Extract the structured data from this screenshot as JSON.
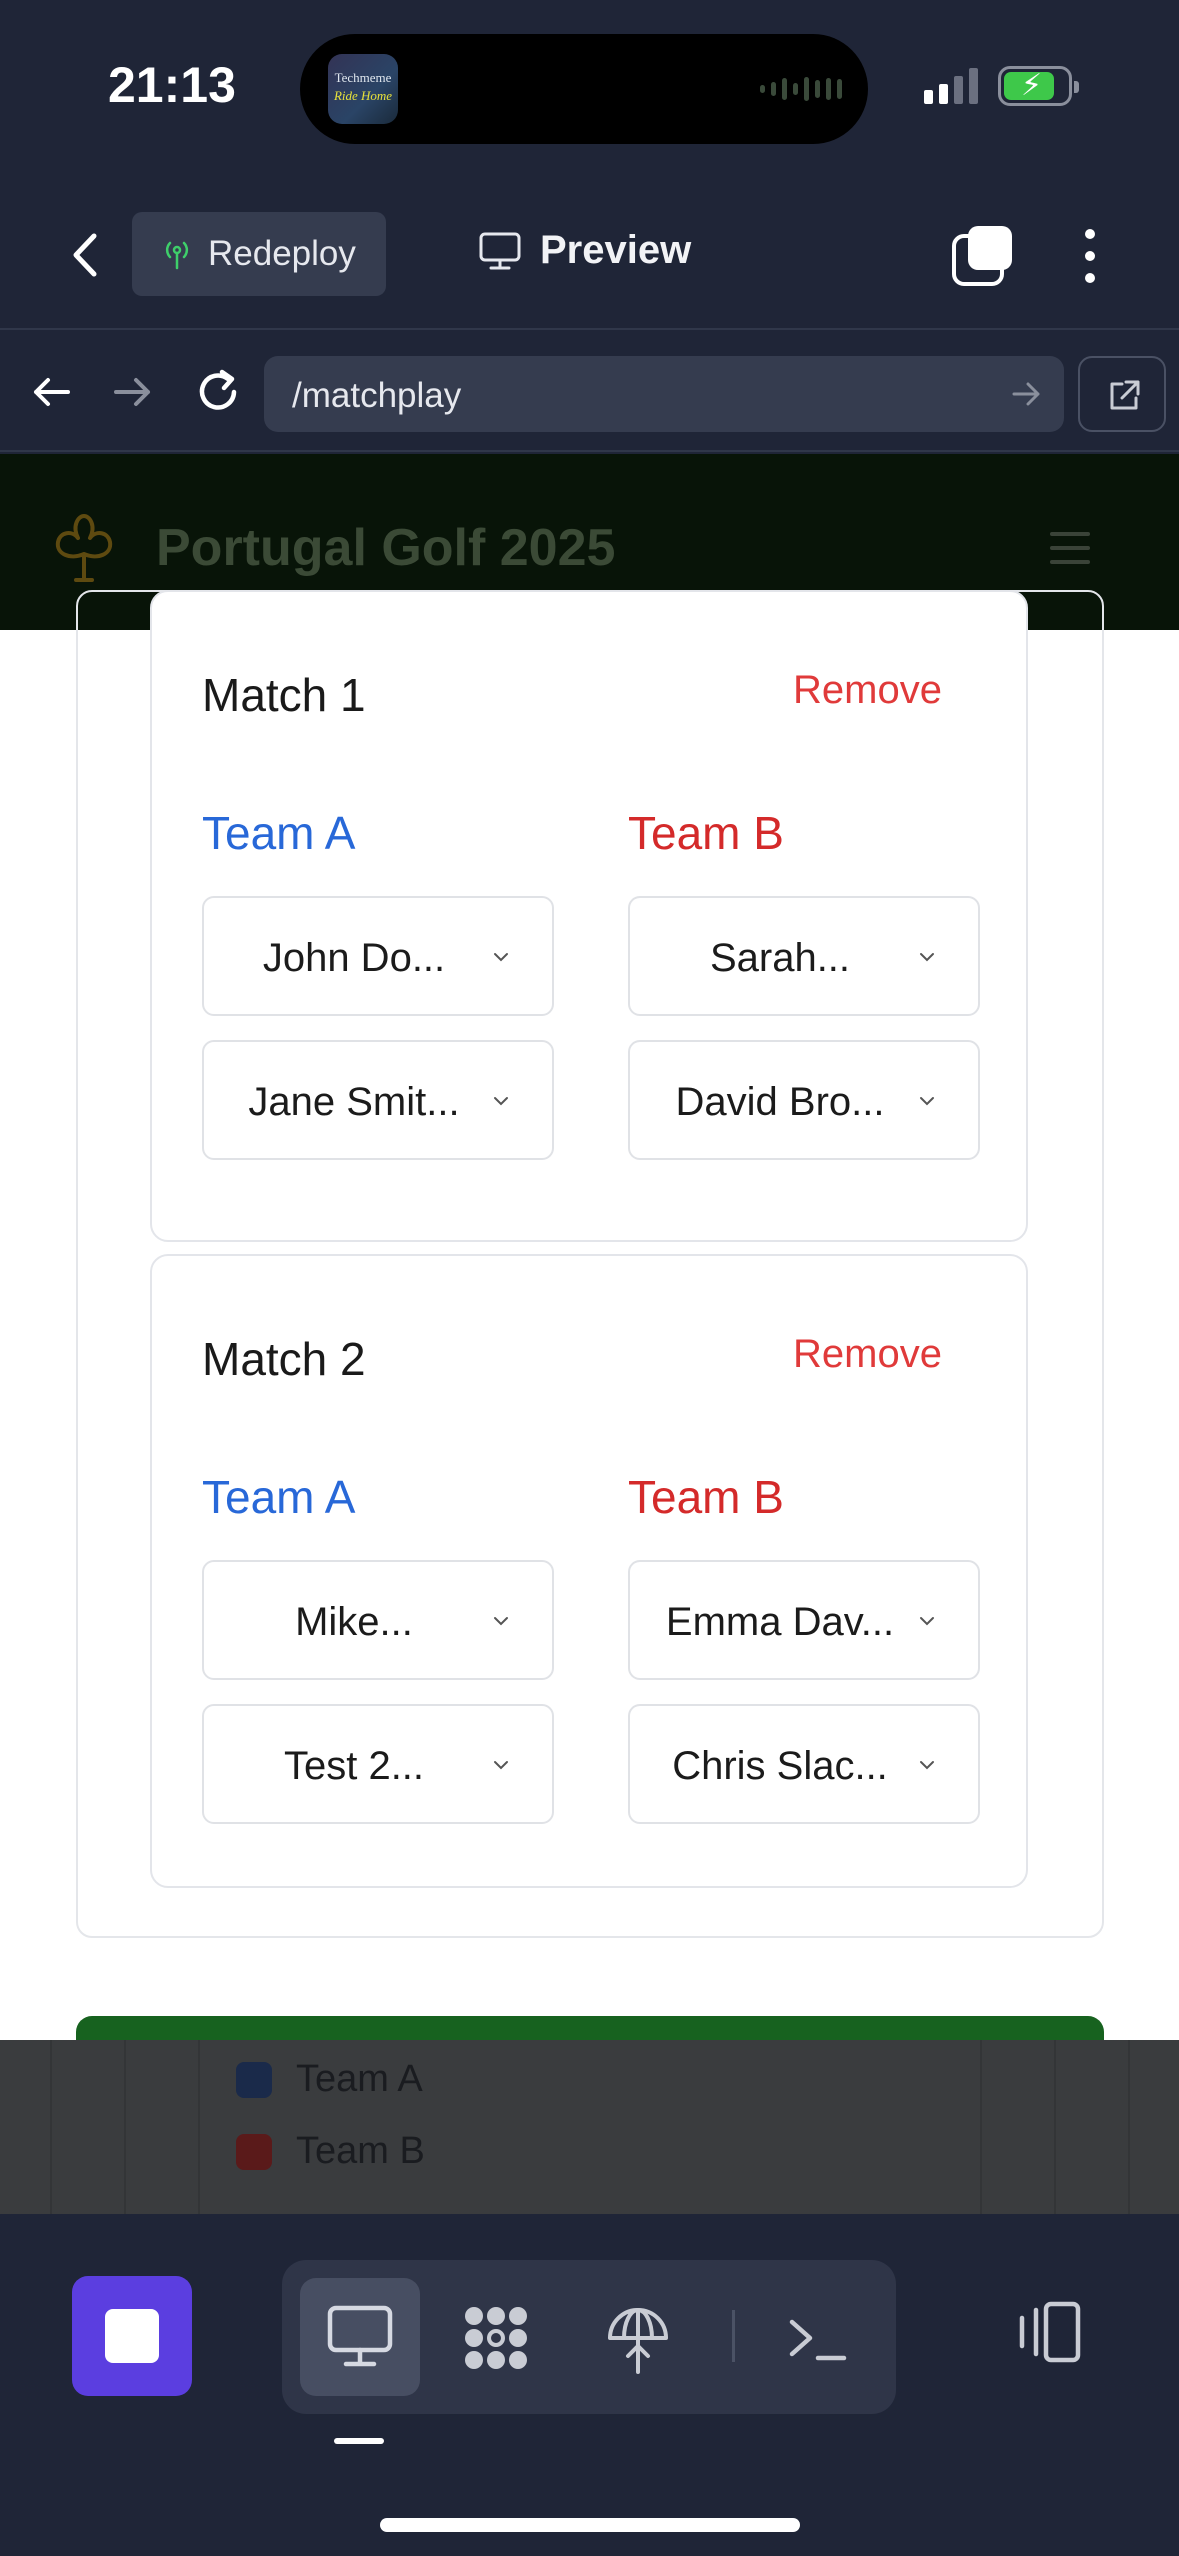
{
  "status_bar": {
    "time": "21:13",
    "now_playing_art_line1": "Techmeme",
    "now_playing_art_line2": "Ride Home",
    "battery_color": "#3ec84a"
  },
  "app_header": {
    "redeploy_label": "Redeploy",
    "preview_label": "Preview",
    "icons": [
      "chevron-left-icon",
      "antenna-icon",
      "monitor-icon",
      "tabs-icon",
      "more-vertical-icon"
    ]
  },
  "url_bar": {
    "url": "/matchplay",
    "icons": [
      "arrow-left-icon",
      "arrow-right-icon",
      "reload-icon",
      "go-arrow-icon",
      "external-link-icon"
    ]
  },
  "site": {
    "title": "Portugal Golf 2025",
    "logo_icon": "clover-icon",
    "menu_icon": "hamburger-icon"
  },
  "matches": [
    {
      "title": "Match 1",
      "remove_label": "Remove",
      "team_a_label": "Team A",
      "team_b_label": "Team B",
      "team_a_players": [
        "John Do...",
        "Jane Smit..."
      ],
      "team_b_players": [
        "Sarah...",
        "David Bro..."
      ]
    },
    {
      "title": "Match 2",
      "remove_label": "Remove",
      "team_a_label": "Team A",
      "team_b_label": "Team B",
      "team_a_players": [
        "Mike...",
        "Test 2..."
      ],
      "team_b_players": [
        "Emma Dav...",
        "Chris Slac..."
      ]
    }
  ],
  "legend": [
    {
      "label": "Team A",
      "color": "#1a2a4a"
    },
    {
      "label": "Team B",
      "color": "#5a1a1a"
    }
  ],
  "colors": {
    "team_a": "#2868d8",
    "team_b": "#d42a2a",
    "remove": "#e03a3a",
    "accent": "#5b3ee0",
    "action_green": "#17621f"
  },
  "bottom_toolbar": {
    "icons": [
      "stop-icon",
      "monitor-icon",
      "packages-icon",
      "deploy-icon",
      "terminal-icon",
      "devices-icon"
    ]
  }
}
